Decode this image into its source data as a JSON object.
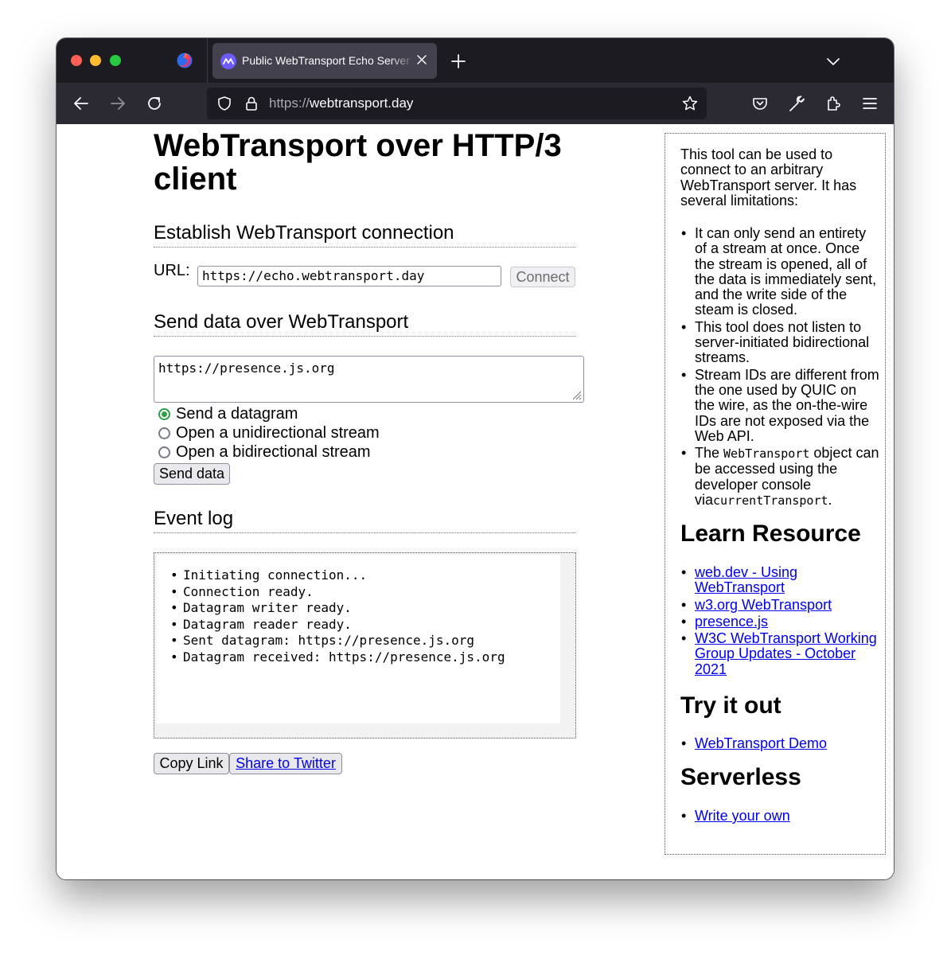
{
  "browser": {
    "tab_title": "Public WebTransport Echo Server",
    "url_scheme": "https://",
    "url_host": "webtransport.day"
  },
  "page": {
    "title": "WebTransport over HTTP/3 client",
    "connect_section": {
      "heading": "Establish WebTransport connection",
      "url_label": "URL:",
      "url_value": "https://echo.webtransport.day",
      "connect_button": "Connect"
    },
    "send_section": {
      "heading": "Send data over WebTransport",
      "data_value": "https://presence.js.org",
      "options": [
        {
          "label": "Send a datagram",
          "checked": true
        },
        {
          "label": "Open a unidirectional stream",
          "checked": false
        },
        {
          "label": "Open a bidirectional stream",
          "checked": false
        }
      ],
      "send_button": "Send data"
    },
    "log_section": {
      "heading": "Event log",
      "entries": [
        "Initiating connection...",
        "Connection ready.",
        "Datagram writer ready.",
        "Datagram reader ready.",
        "Sent datagram: https://presence.js.org",
        "Datagram received: https://presence.js.org"
      ]
    },
    "footer_buttons": {
      "copy_link": "Copy Link",
      "share_twitter": "Share to Twitter"
    }
  },
  "sidebar": {
    "intro": "This tool can be used to connect to an arbitrary WebTransport server. It has several limitations:",
    "limitations": {
      "item1": "It can only send an entirety of a stream at once. Once the stream is opened, all of the data is immediately sent, and the write side of the steam is closed.",
      "item2": "This tool does not listen to server-initiated bidirectional streams.",
      "item3": "Stream IDs are different from the one used by QUIC on the wire, as the on-the-wire IDs are not exposed via the Web API.",
      "item4_a": "The ",
      "item4_code1": "WebTransport",
      "item4_b": " object can be accessed using the developer console via",
      "item4_code2": "currentTransport",
      "item4_c": "."
    },
    "learn_heading": "Learn Resource",
    "learn_links": [
      "web.dev - Using WebTransport",
      "w3.org WebTransport",
      "presence.js",
      "W3C WebTransport Working Group Updates - October 2021"
    ],
    "try_heading": "Try it out",
    "try_links": [
      "WebTransport Demo"
    ],
    "serverless_heading": "Serverless",
    "serverless_links": [
      "Write your own"
    ]
  }
}
